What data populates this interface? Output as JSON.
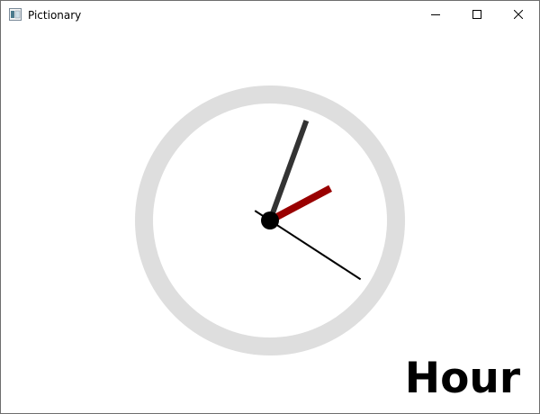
{
  "window": {
    "title": "Pictionary",
    "app_icon": "window-app-icon",
    "controls": [
      {
        "name": "minimize-button",
        "icon": "minimize-icon"
      },
      {
        "name": "maximize-button",
        "icon": "maximize-icon"
      },
      {
        "name": "close-button",
        "icon": "close-icon"
      }
    ]
  },
  "clock": {
    "hour_angle_deg": 62,
    "minute_angle_deg": 20,
    "second_angle_deg": 123,
    "colors": {
      "ring": "#dedede",
      "hour_hand": "#990000",
      "minute_hand": "#333333",
      "second_hand": "#000000",
      "hub": "#000000"
    }
  },
  "mode_label": "Hour"
}
